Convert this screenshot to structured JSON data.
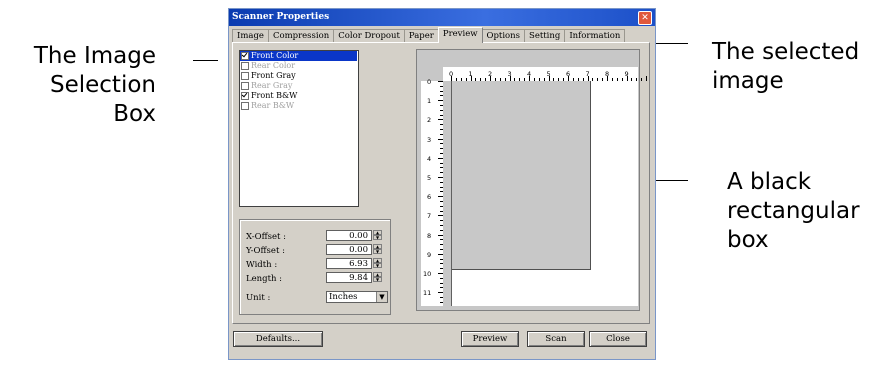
{
  "callouts": {
    "image_selection_box": [
      "The Image",
      "Selection",
      "Box"
    ],
    "selected_image": [
      "The selected",
      "image"
    ],
    "black_box": [
      "A black",
      "rectangular",
      "box"
    ]
  },
  "window": {
    "title": "Scanner Properties",
    "close_glyph": "✕"
  },
  "tabs": [
    {
      "label": "Image",
      "active": false
    },
    {
      "label": "Compression",
      "active": false
    },
    {
      "label": "Color Dropout",
      "active": false
    },
    {
      "label": "Paper",
      "active": false
    },
    {
      "label": "Preview",
      "active": true
    },
    {
      "label": "Options",
      "active": false
    },
    {
      "label": "Setting",
      "active": false
    },
    {
      "label": "Information",
      "active": false
    }
  ],
  "image_list": [
    {
      "label": "Front Color",
      "checked": true,
      "selected": true,
      "enabled": true
    },
    {
      "label": "Rear Color",
      "checked": false,
      "selected": false,
      "enabled": false
    },
    {
      "label": "Front Gray",
      "checked": false,
      "selected": false,
      "enabled": true
    },
    {
      "label": "Rear Gray",
      "checked": false,
      "selected": false,
      "enabled": false
    },
    {
      "label": "Front B&W",
      "checked": true,
      "selected": false,
      "enabled": true
    },
    {
      "label": "Rear B&W",
      "checked": false,
      "selected": false,
      "enabled": false
    }
  ],
  "fields": {
    "x_offset": {
      "label": "X-Offset :",
      "value": "0.00"
    },
    "y_offset": {
      "label": "Y-Offset :",
      "value": "0.00"
    },
    "width": {
      "label": "Width :",
      "value": "6.93"
    },
    "length": {
      "label": "Length :",
      "value": "9.84"
    },
    "unit": {
      "label": "Unit :",
      "value": "Inches"
    }
  },
  "ruler": {
    "x_labels": [
      "0",
      "1",
      "2",
      "3",
      "4",
      "5",
      "6",
      "7",
      "8",
      "9"
    ],
    "y_labels": [
      "0",
      "1",
      "2",
      "3",
      "4",
      "5",
      "6",
      "7",
      "8",
      "9",
      "10",
      "11"
    ]
  },
  "buttons": {
    "defaults": "Defaults...",
    "preview": "Preview",
    "scan": "Scan",
    "close": "Close"
  },
  "colors": {
    "title_bar": "#0a3bb0",
    "selection": "#0a36c8",
    "dialog_bg": "#d4d0c8",
    "preview_bg": "#c7c7c7"
  }
}
